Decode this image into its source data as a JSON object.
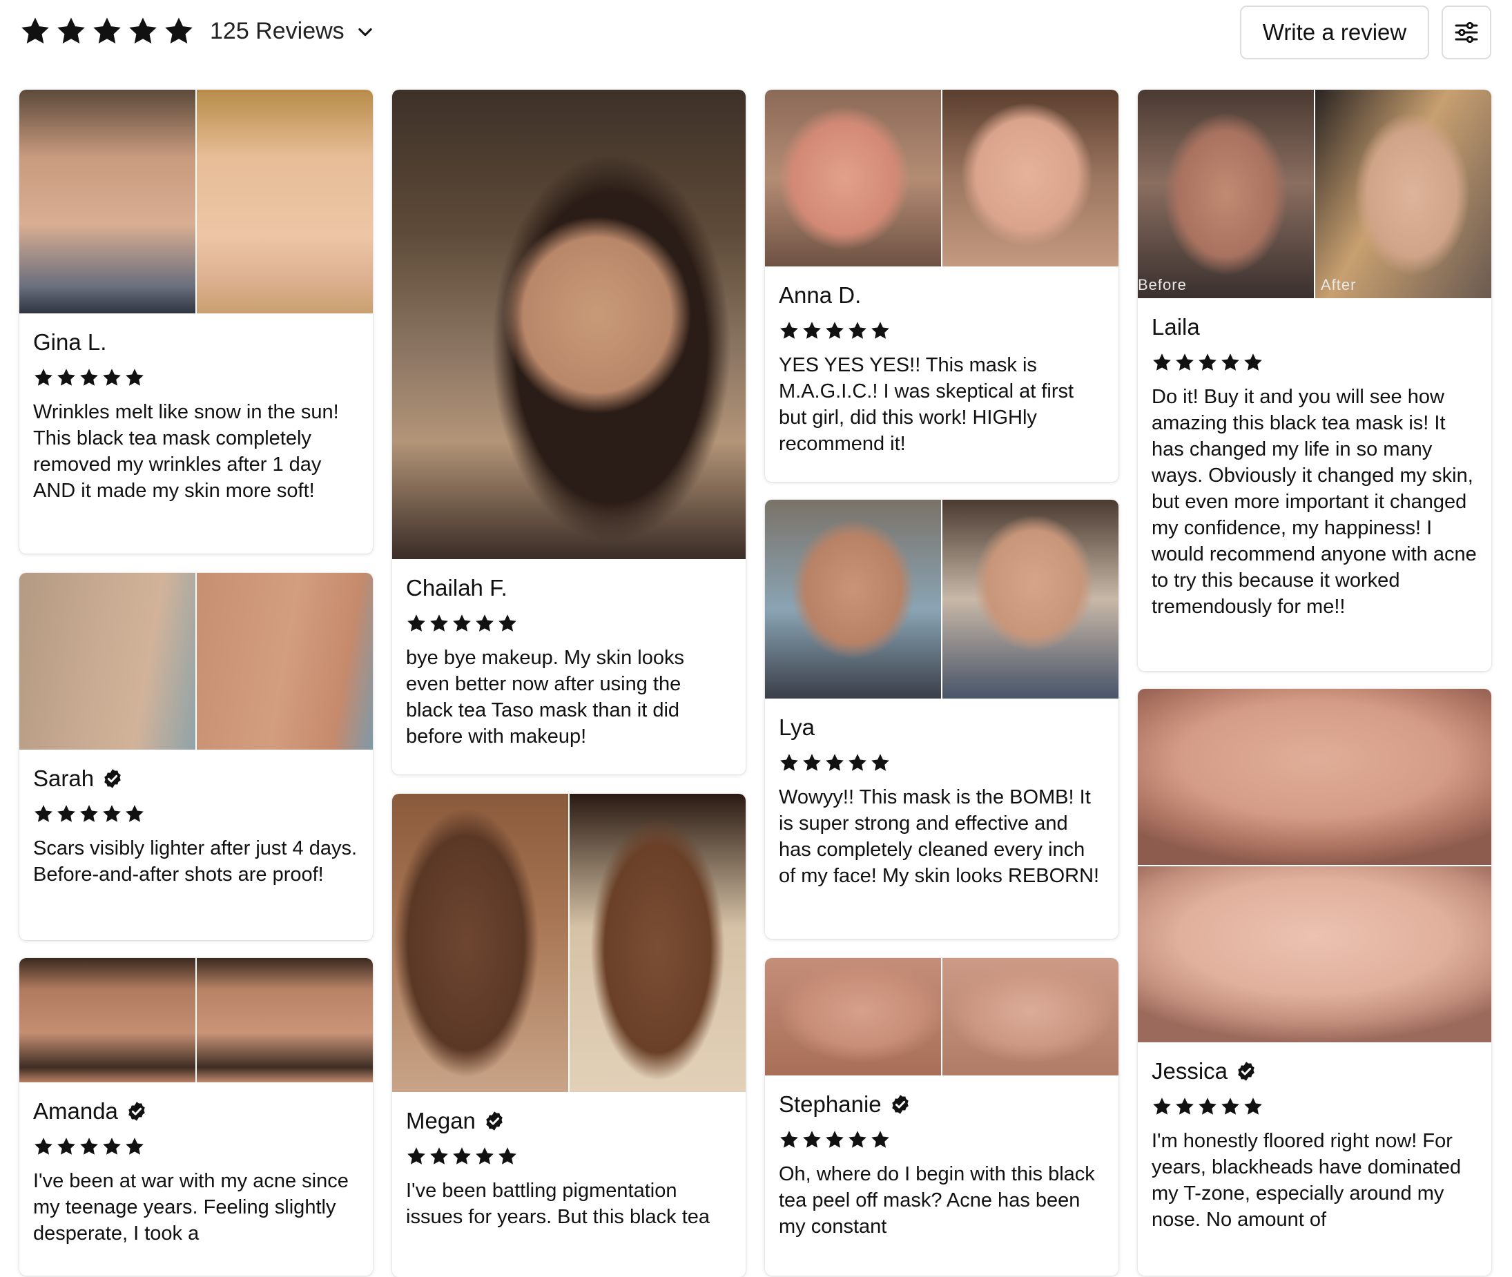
{
  "header": {
    "rating_stars": 5,
    "review_count_label": "125 Reviews",
    "write_review_label": "Write a review"
  },
  "colors": {
    "star": "#111111",
    "card_bg": "#ffffff",
    "border": "#dddddd"
  },
  "reviews": [
    {
      "name": "Gina L.",
      "verified": false,
      "stars": 5,
      "text": "Wrinkles melt like snow in the sun! This black tea mask completely removed my wrinkles after 1 day AND it made my skin more soft!"
    },
    {
      "name": "Sarah",
      "verified": true,
      "stars": 5,
      "text": "Scars visibly lighter after just 4 days. Before-and-after shots are proof!"
    },
    {
      "name": "Amanda",
      "verified": true,
      "stars": 5,
      "text": "I've been at war with my acne since my teenage years. Feeling slightly desperate, I took a"
    },
    {
      "name": "Chailah F.",
      "verified": false,
      "stars": 5,
      "text": "bye bye makeup. My skin looks even better now after using the black tea Taso mask than it did before with makeup!"
    },
    {
      "name": "Megan",
      "verified": true,
      "stars": 5,
      "text": "I've been battling pigmentation issues for years. But this black tea"
    },
    {
      "name": "Anna D.",
      "verified": false,
      "stars": 5,
      "text": "YES YES YES!! This mask is M.A.G.I.C.! I was skeptical at first but girl, did this work! HIGHly recommend it!"
    },
    {
      "name": "Lya",
      "verified": false,
      "stars": 5,
      "text": "Wowyy!! This mask is the BOMB! It is super strong and effective and has completely cleaned every inch of my face! My skin looks REBORN!"
    },
    {
      "name": "Stephanie",
      "verified": true,
      "stars": 5,
      "text": "Oh, where do I begin with this black tea peel off mask? Acne has been my constant"
    },
    {
      "name": "Laila",
      "verified": false,
      "stars": 5,
      "text": "Do it! Buy it and you will see how amazing this black tea mask is! It has changed my life in so many ways. Obviously it changed my skin, but even more important it changed my confidence, my happiness! I would recommend anyone with acne to try this because it worked tremendously for me!!",
      "photo_labels": [
        "Before",
        "After"
      ]
    },
    {
      "name": "Jessica",
      "verified": true,
      "stars": 5,
      "text": "I'm honestly floored right now! For years, blackheads have dominated my T-zone, especially around my nose. No amount of"
    }
  ]
}
